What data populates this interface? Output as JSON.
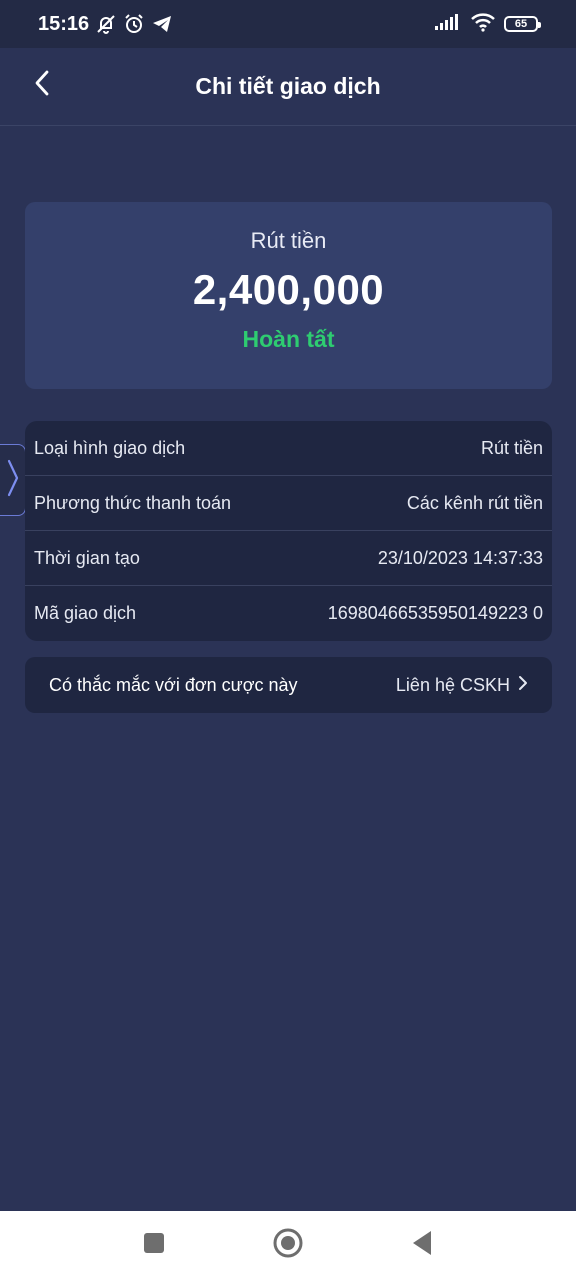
{
  "status_bar": {
    "time": "15:16",
    "battery": "65",
    "icons": [
      "mute-icon",
      "alarm-icon",
      "telegram-icon",
      "signal-icon",
      "wifi-icon",
      "battery-icon"
    ]
  },
  "header": {
    "title": "Chi tiết giao dịch",
    "back_icon": "chevron-left-icon"
  },
  "summary": {
    "type": "Rút tiền",
    "amount": "2,400,000",
    "status": "Hoàn tất",
    "status_color": "#2ecc71"
  },
  "details": [
    {
      "label": "Loại hình giao dịch",
      "value": "Rút tiền"
    },
    {
      "label": "Phương thức thanh toán",
      "value": "Các kênh rút tiền"
    },
    {
      "label": "Thời gian tạo",
      "value": "23/10/2023 14:37:33"
    },
    {
      "label": "Mã giao dịch",
      "value": "16980466535950149223 0"
    }
  ],
  "support": {
    "question": "Có thắc mắc với đơn cược này",
    "link_label": "Liên hệ CSKH"
  },
  "colors": {
    "background": "#2b3356",
    "card": "#34406b",
    "panel": "#1f2641",
    "accent": "#6b7bd6"
  },
  "nav": {
    "icons": [
      "recent-apps-icon",
      "home-icon",
      "back-icon"
    ]
  }
}
